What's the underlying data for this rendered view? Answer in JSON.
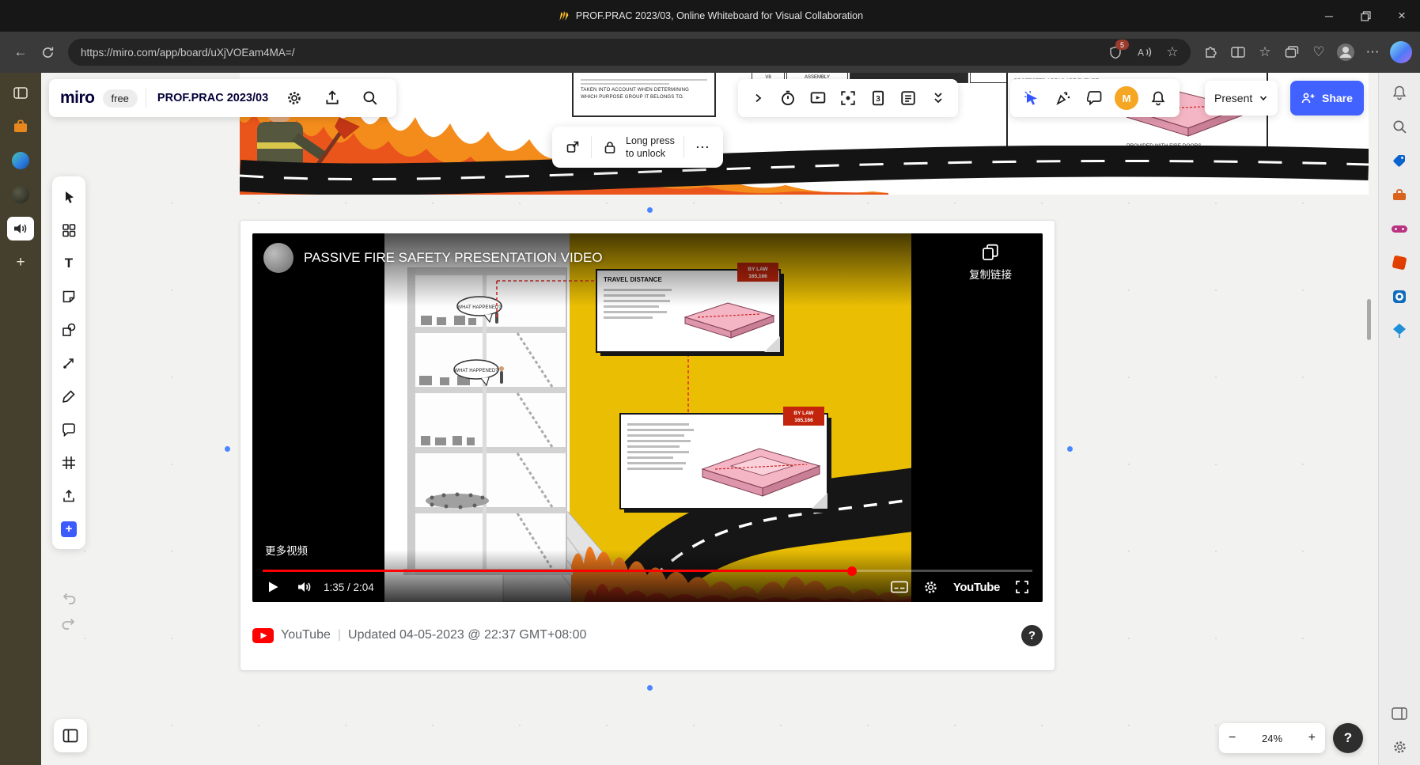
{
  "browser": {
    "window_title": "PROF.PRAC 2023/03, Online Whiteboard for Visual Collaboration",
    "url": "https://miro.com/app/board/uXjVOEam4MA=/",
    "shield_badge": "5",
    "read_aloud_glyph": "A",
    "minimize_glyph": "─",
    "close_glyph": "×",
    "back_glyph": "←",
    "more_glyph": "⋯",
    "favorites_glyph": "☆",
    "essentials_glyph": "♡"
  },
  "rail": {
    "add_glyph": "+"
  },
  "header": {
    "logo": "miro",
    "plan": "free",
    "board_title": "PROF.PRAC 2023/03",
    "pages_badge": "3",
    "present_label": "Present",
    "share_label": "Share",
    "avatar_initial": "M"
  },
  "toolbar": {
    "text_glyph": "T"
  },
  "lock_toolbar": {
    "line1": "Long press",
    "line2": "to unlock",
    "more_glyph": "⋯"
  },
  "poster": {
    "doc_text": "TAKEN INTO ACCOUNT WHEN DETERMINING WHICH PURPOSE GROUP IT BELONGS TO.",
    "cell_v8": "V8",
    "cell_assembly": "ASSEMBLY",
    "right_caption_top": "PROTECTED AREAS ARE EXEMPT",
    "right_caption_bottom": "PROVIDED WITH FIRE DOORS."
  },
  "video": {
    "title": "PASSIVE FIRE SAFETY PRESENTATION VIDEO",
    "copy_link_label": "复制链接",
    "more_videos_label": "更多视频",
    "time": "1:35 / 2:04",
    "progress_style": "width:76.6%",
    "youtube_wordmark": "YouTube",
    "scene": {
      "card1_title": "TRAVEL DISTANCE",
      "bylaw_line1": "BY LAW",
      "bylaw_line2": "165,166",
      "bubble1": "WHAT HAPPENED?",
      "bubble2": "WHAT HAPPENED?"
    }
  },
  "footer": {
    "source": "YouTube",
    "separator": "|",
    "updated": "Updated 04-05-2023 @ 22:37 GMT+08:00",
    "help_glyph": "?"
  },
  "zoom": {
    "out_glyph": "−",
    "level": "24%",
    "in_glyph": "+",
    "help_glyph": "?"
  },
  "colors": {
    "share_blue": "#4262ff",
    "selection_blue": "#4a86ff",
    "youtube_red": "#ff0000",
    "scene_yellow": "#e9be03",
    "avatar_orange": "#f5a623",
    "flame_orange": "#f48c1c"
  },
  "icons": [
    "back-icon",
    "refresh-icon",
    "shield-icon",
    "read-aloud-icon",
    "favorite-star-icon",
    "extensions-icon",
    "split-screen-icon",
    "favorites-bar-icon",
    "collections-icon",
    "essentials-icon",
    "profile-avatar-icon",
    "more-icon",
    "copilot-icon",
    "panel-toggle-icon",
    "office-app-icon",
    "edge-app-icon",
    "app-icon",
    "speaker-icon",
    "add-icon",
    "select-cursor-icon",
    "templates-icon",
    "text-icon",
    "sticky-note-icon",
    "shapes-icon",
    "connector-icon",
    "pen-icon",
    "comment-icon",
    "frame-icon",
    "upload-icon",
    "more-apps-icon",
    "undo-icon",
    "redo-icon",
    "settings-gear-icon",
    "export-icon",
    "search-icon",
    "chevron-right-icon",
    "timer-icon",
    "screen-share-icon",
    "frame-capture-icon",
    "pages-icon",
    "notes-icon",
    "collapse-chevrons-icon",
    "laser-pointer-icon",
    "reactions-icon",
    "chat-icon",
    "notifications-bell-icon",
    "chevron-down-icon",
    "share-person-icon",
    "open-in-new-icon",
    "lock-icon",
    "copy-icon",
    "play-icon",
    "volume-icon",
    "subtitles-icon",
    "player-settings-icon",
    "fullscreen-icon",
    "youtube-icon",
    "help-icon",
    "frames-panel-icon",
    "sidebar-bell-icon",
    "sidebar-search-icon",
    "shopping-icon",
    "tools-icon",
    "games-icon",
    "m365-icon",
    "outlook-icon",
    "drop-icon",
    "sidebar-panel-icon",
    "sidebar-settings-icon"
  ]
}
